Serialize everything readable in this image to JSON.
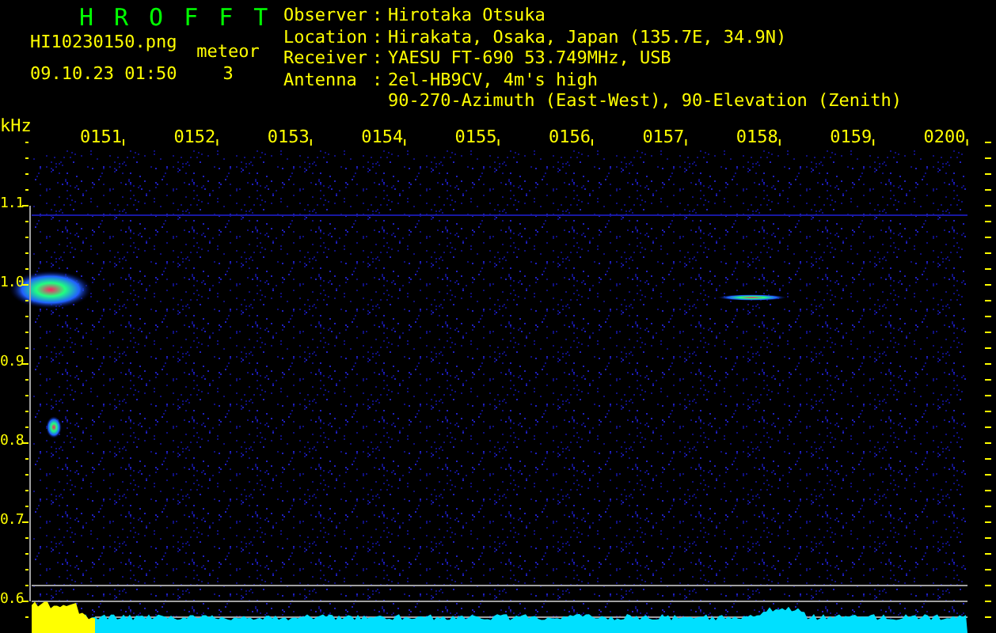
{
  "app": {
    "title": "HROFFT",
    "filename": "HI10230150.png",
    "datetime": "09.10.23 01:50",
    "count_label": "meteor",
    "count": "3"
  },
  "station": [
    {
      "label": "Observer",
      "separator": ":",
      "lines": [
        "Hirotaka Otsuka"
      ]
    },
    {
      "label": "Location",
      "separator": ":",
      "lines": [
        "Hirakata, Osaka, Japan (135.7E, 34.9N)"
      ]
    },
    {
      "label": "Receiver",
      "separator": ":",
      "lines": [
        "YAESU FT-690 53.749MHz, USB"
      ]
    },
    {
      "label": "Antenna",
      "separator": ":",
      "lines": [
        "2el-HB9CV, 4m's high",
        "90-270-Azimuth (East-West), 90-Elevation (Zenith)"
      ]
    }
  ],
  "spectrogram": {
    "unit": "kHz",
    "time_labels": [
      "0151",
      "0152",
      "0153",
      "0154",
      "0155",
      "0156",
      "0157",
      "0158",
      "0159",
      "0200"
    ],
    "freq_labels": [
      "1.1",
      "1.0",
      "0.9",
      "0.8",
      "0.7",
      "0.6"
    ]
  }
}
